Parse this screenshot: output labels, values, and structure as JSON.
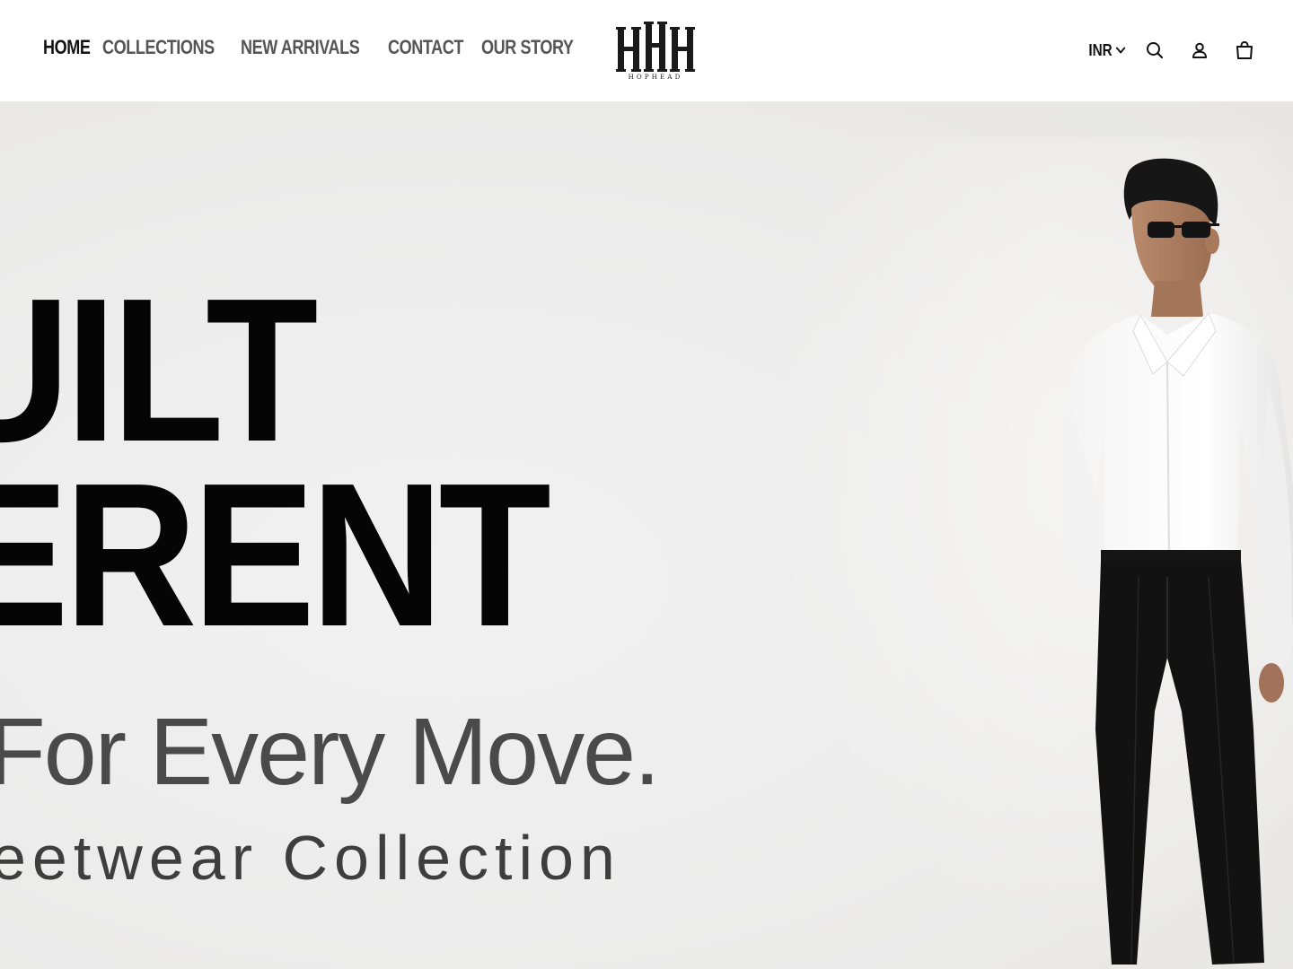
{
  "header": {
    "nav": [
      {
        "label": "HOME",
        "active": true
      },
      {
        "label": "COLLECTIONS"
      },
      {
        "label": "NEW ARRIVALS"
      },
      {
        "label": "CONTACT"
      },
      {
        "label": "OUR STORY"
      }
    ],
    "logo": {
      "wordmark": "HOPHEAD"
    },
    "currency": "INR",
    "icons": [
      "chevron-down-icon",
      "search-icon",
      "account-icon",
      "cart-icon"
    ]
  },
  "hero": {
    "line1": "UILT",
    "line2": "ERENT",
    "line3": "For Every Move.",
    "line4": "eetwear Collection"
  },
  "colors": {
    "text_primary": "#111111",
    "nav_inactive": "#555555",
    "hero_bg": "#ededed",
    "headline": "#050505"
  }
}
